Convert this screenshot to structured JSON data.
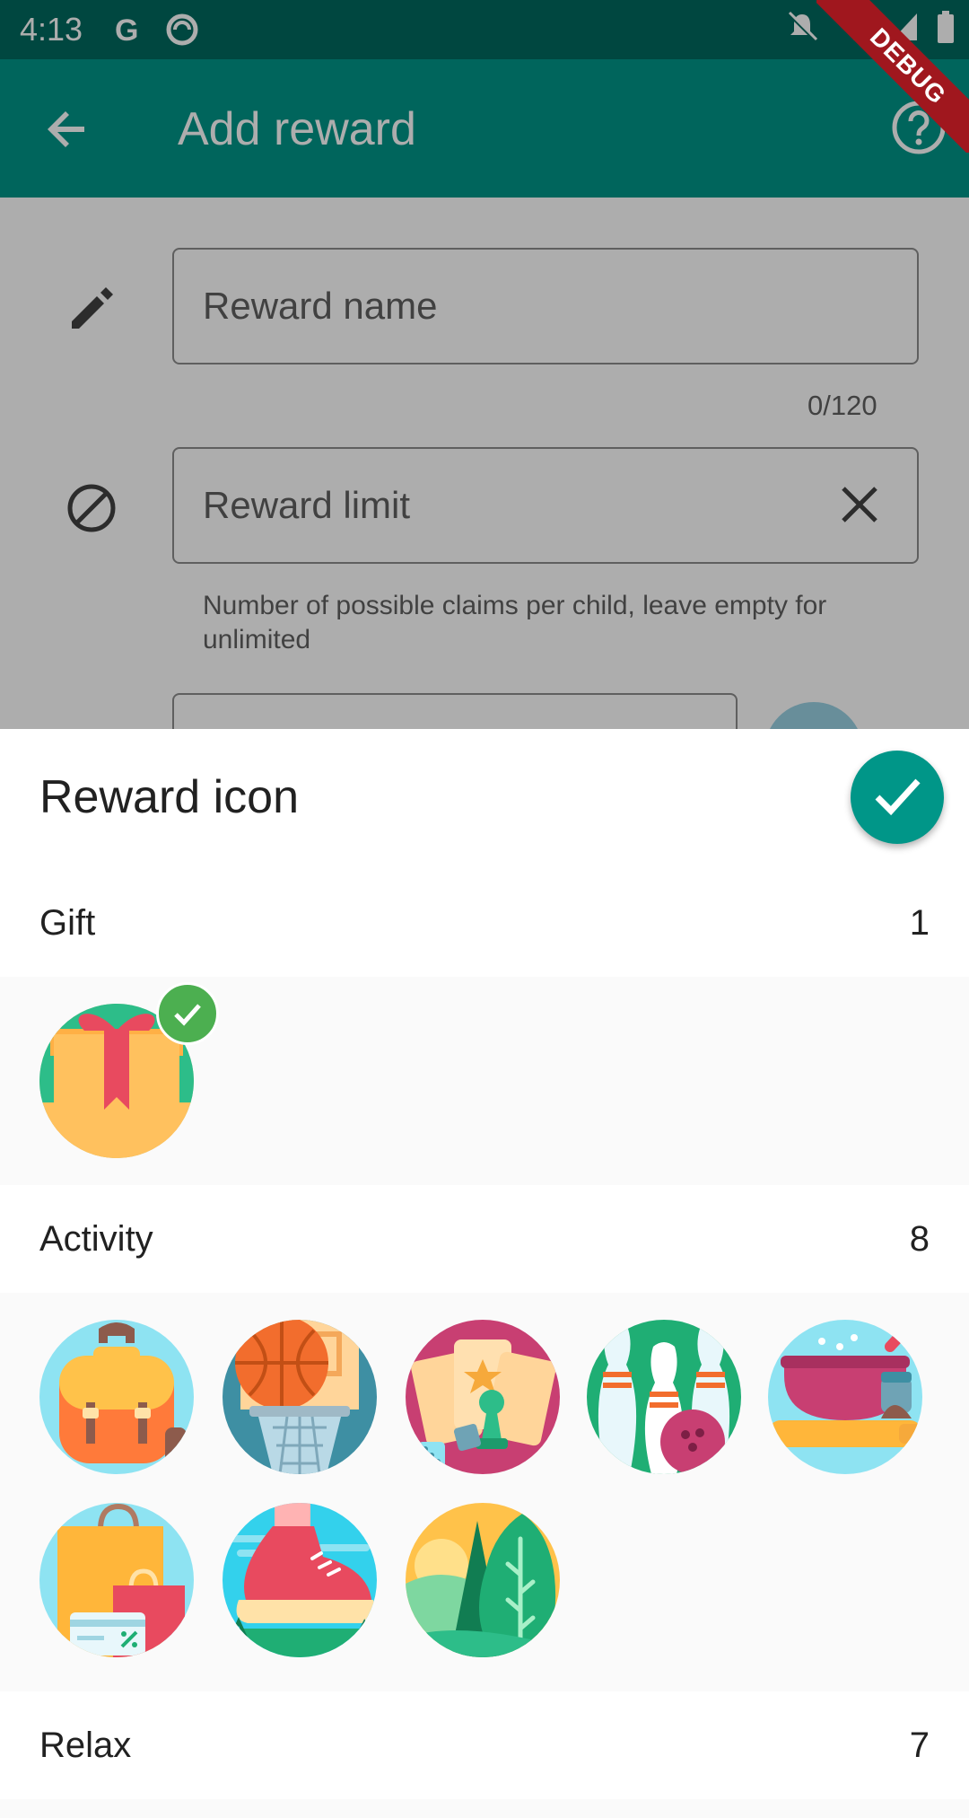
{
  "status_bar": {
    "time": "4:13"
  },
  "app_bar": {
    "title": "Add reward"
  },
  "debug_banner": "DEBUG",
  "form": {
    "name_field": {
      "placeholder": "Reward name",
      "counter": "0/120"
    },
    "limit_field": {
      "placeholder": "Reward limit",
      "helper": "Number of possible claims per child, leave empty for unlimited"
    }
  },
  "sheet": {
    "title": "Reward icon",
    "categories": [
      {
        "name": "Gift",
        "count": "1"
      },
      {
        "name": "Activity",
        "count": "8"
      },
      {
        "name": "Relax",
        "count": "7"
      }
    ]
  },
  "icons": {
    "gift": [
      "gift-icon"
    ],
    "activity": [
      "backpack-icon",
      "basketball-icon",
      "board-game-icon",
      "bowling-icon",
      "baking-icon",
      "shopping-icon",
      "sneaker-icon",
      "forest-icon"
    ]
  },
  "colors": {
    "primary": "#009688",
    "status": "#00695f",
    "selected": "#4caf50"
  }
}
